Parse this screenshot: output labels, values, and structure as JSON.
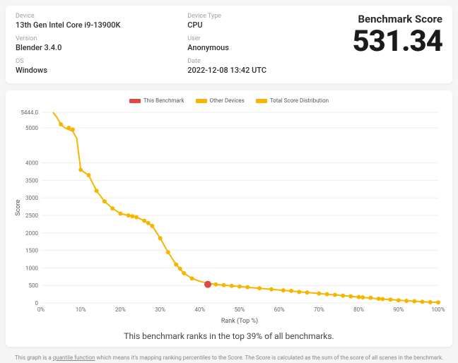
{
  "meta": {
    "device_label": "Device",
    "device_value": "13th Gen Intel Core i9-13900K",
    "device_type_label": "Device Type",
    "device_type_value": "CPU",
    "version_label": "Version",
    "version_value": "Blender 3.4.0",
    "user_label": "User",
    "user_value": "Anonymous",
    "os_label": "OS",
    "os_value": "Windows",
    "date_label": "Date",
    "date_value": "2022-12-08 13:42 UTC"
  },
  "score": {
    "title": "Benchmark Score",
    "value": "531.34"
  },
  "legend": {
    "this": "This Benchmark",
    "other": "Other Devices",
    "dist": "Total Score Distribution"
  },
  "rank_text": "This benchmark ranks in the top 39% of all benchmarks.",
  "footnote_prefix": "This graph is a ",
  "footnote_link": "quantile function",
  "footnote_suffix": " which means it's mapping ranking percentiles to the Score. The Score is calculated as the sum of the score of all scenes in the benchmark.",
  "chart_data": {
    "type": "line",
    "title": "",
    "xlabel": "Rank (Top %)",
    "ylabel": "Score",
    "xlim": [
      0,
      100
    ],
    "ylim": [
      0,
      5444
    ],
    "y_ticks": [
      0,
      500,
      1000,
      1500,
      2000,
      2500,
      3000,
      3500,
      4000,
      5000,
      5444
    ],
    "x_ticks": [
      0,
      10,
      20,
      30,
      40,
      50,
      60,
      70,
      80,
      90,
      100
    ],
    "series": [
      {
        "name": "Total Score Distribution",
        "x": [
          3,
          4,
          5,
          6,
          7,
          8,
          9,
          10,
          12,
          14,
          16,
          18,
          20,
          22,
          24,
          26,
          28,
          30,
          32,
          34,
          36,
          38,
          40,
          42,
          44,
          46,
          48,
          50,
          52,
          55,
          58,
          61,
          64,
          67,
          70,
          73,
          76,
          79,
          82,
          85,
          88,
          91,
          94,
          97,
          100
        ],
        "y": [
          5444,
          5300,
          5100,
          5000,
          4950,
          4900,
          4700,
          3800,
          3650,
          3200,
          2900,
          2700,
          2550,
          2500,
          2450,
          2350,
          2200,
          1850,
          1450,
          1100,
          850,
          700,
          620,
          560,
          530,
          510,
          490,
          470,
          450,
          420,
          390,
          360,
          330,
          300,
          270,
          240,
          210,
          180,
          150,
          120,
          95,
          70,
          50,
          30,
          15
        ]
      }
    ],
    "dots_other": [
      {
        "x": 5,
        "y": 5100
      },
      {
        "x": 7,
        "y": 5000
      },
      {
        "x": 8,
        "y": 4950
      },
      {
        "x": 10,
        "y": 3800
      },
      {
        "x": 12,
        "y": 3650
      },
      {
        "x": 14,
        "y": 3200
      },
      {
        "x": 16,
        "y": 2900
      },
      {
        "x": 18,
        "y": 2700
      },
      {
        "x": 20,
        "y": 2550
      },
      {
        "x": 22,
        "y": 2500
      },
      {
        "x": 23,
        "y": 2475
      },
      {
        "x": 24,
        "y": 2450
      },
      {
        "x": 26,
        "y": 2350
      },
      {
        "x": 27,
        "y": 2280
      },
      {
        "x": 28,
        "y": 2200
      },
      {
        "x": 30,
        "y": 1850
      },
      {
        "x": 32,
        "y": 1450
      },
      {
        "x": 34,
        "y": 1100
      },
      {
        "x": 35,
        "y": 980
      },
      {
        "x": 36,
        "y": 850
      },
      {
        "x": 38,
        "y": 700
      },
      {
        "x": 44,
        "y": 530
      },
      {
        "x": 46,
        "y": 510
      },
      {
        "x": 48,
        "y": 490
      },
      {
        "x": 50,
        "y": 470
      },
      {
        "x": 52,
        "y": 450
      },
      {
        "x": 55,
        "y": 420
      },
      {
        "x": 58,
        "y": 390
      },
      {
        "x": 61,
        "y": 360
      },
      {
        "x": 63,
        "y": 345
      },
      {
        "x": 65,
        "y": 315
      },
      {
        "x": 67,
        "y": 300
      },
      {
        "x": 70,
        "y": 270
      },
      {
        "x": 72,
        "y": 250
      },
      {
        "x": 74,
        "y": 232
      },
      {
        "x": 76,
        "y": 210
      },
      {
        "x": 78,
        "y": 190
      },
      {
        "x": 80,
        "y": 170
      },
      {
        "x": 81,
        "y": 160
      },
      {
        "x": 83,
        "y": 145
      },
      {
        "x": 85,
        "y": 120
      },
      {
        "x": 86,
        "y": 110
      },
      {
        "x": 88,
        "y": 95
      },
      {
        "x": 90,
        "y": 78
      },
      {
        "x": 92,
        "y": 60
      },
      {
        "x": 94,
        "y": 50
      },
      {
        "x": 96,
        "y": 35
      },
      {
        "x": 98,
        "y": 22
      },
      {
        "x": 100,
        "y": 15
      }
    ],
    "dot_this": {
      "x": 42,
      "y": 531
    }
  }
}
